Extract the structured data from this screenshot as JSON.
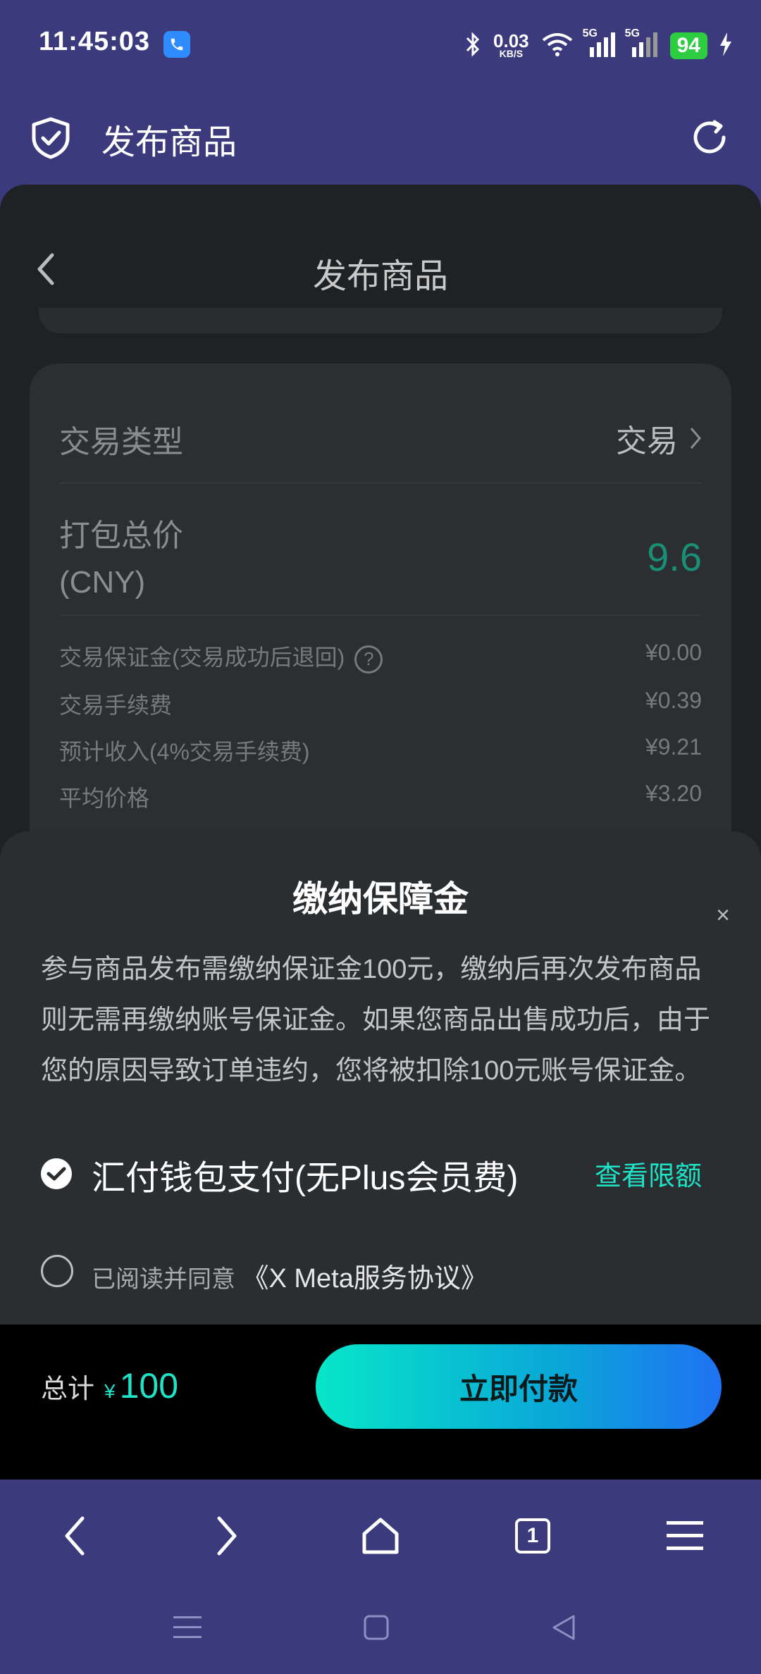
{
  "status_bar": {
    "time": "11:45:03",
    "net_speed": "0.03",
    "net_speed_unit": "KB/S",
    "sim1": "5G",
    "sim2": "5G",
    "battery": "94"
  },
  "app_bar": {
    "title": "发布商品",
    "shield_icon": "shield-check-icon",
    "refresh_icon": "refresh-icon"
  },
  "page": {
    "title": "发布商品",
    "trade_type_label": "交易类型",
    "trade_type_value": "交易",
    "total_price_label_line1": "打包总价",
    "total_price_label_line2": "(CNY)",
    "total_price_value": "9.6",
    "fees": [
      {
        "label": "交易保证金(交易成功后退回)",
        "value": "¥0.00",
        "has_help": true
      },
      {
        "label": "交易手续费",
        "value": "¥0.39"
      },
      {
        "label": "预计收入(4%交易手续费)",
        "value": "¥9.21"
      },
      {
        "label": "平均价格",
        "value": "¥3.20"
      }
    ]
  },
  "sheet": {
    "title": "缴纳保障金",
    "close": "×",
    "description": "参与商品发布需缴纳保证金100元，缴纳后再次发布商品则无需再缴纳账号保证金。如果您商品出售成功后，由于您的原因导致订单违约，您将被扣除100元账号保证金。",
    "payment_method": "汇付钱包支付(无Plus会员费)",
    "view_limit": "查看限额",
    "agree_prefix": "已阅读并同意",
    "agree_link": "《X Meta服务协议》"
  },
  "footer": {
    "total_label": "总计",
    "currency": "¥",
    "total_amount": "100",
    "pay_button": "立即付款"
  },
  "browser_nav": {
    "tab_count": "1"
  },
  "colors": {
    "frame": "#3a3a7c",
    "accent": "#1ee3c7",
    "price_green": "#1b8f75"
  }
}
